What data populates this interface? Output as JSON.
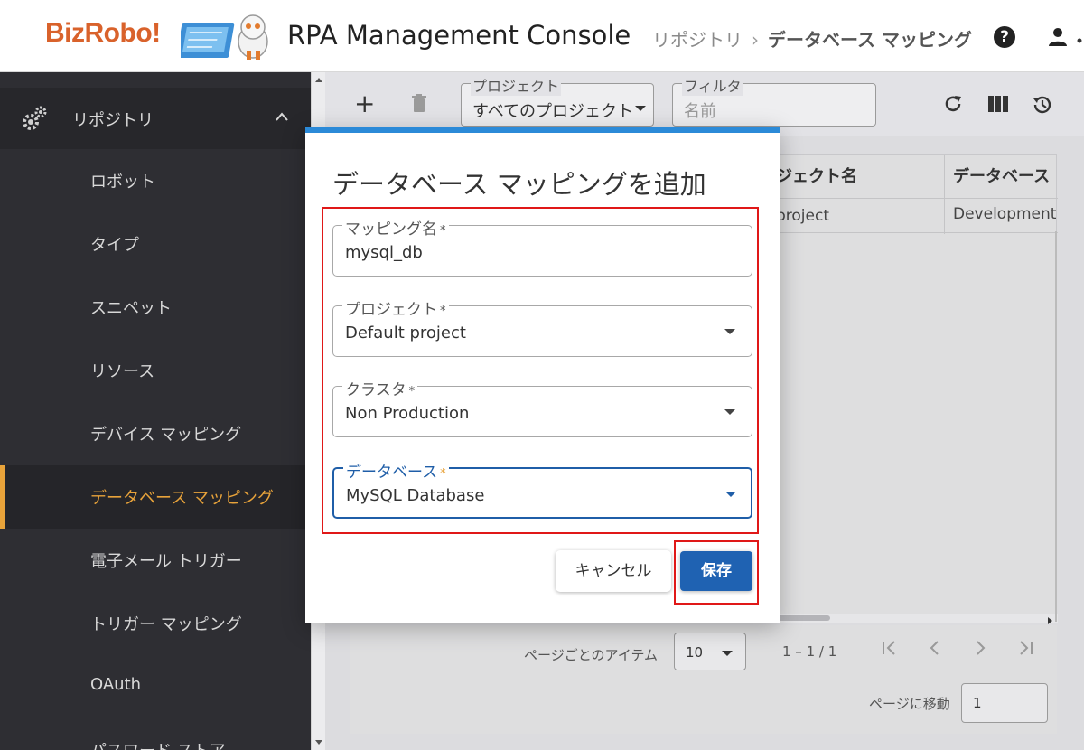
{
  "header": {
    "logo_text": "BizRobo!",
    "app_title": "RPA Management Console",
    "breadcrumb": {
      "parent": "リポジトリ",
      "separator": "›",
      "current": "データベース マッピング"
    },
    "help_glyph": "?",
    "icons": [
      "help-icon",
      "user-icon"
    ]
  },
  "sidebar": {
    "parent": {
      "label": "リポジトリ",
      "icon": "gear-icon",
      "expanded": true
    },
    "items": [
      {
        "label": "ロボット"
      },
      {
        "label": "タイプ"
      },
      {
        "label": "スニペット"
      },
      {
        "label": "リソース"
      },
      {
        "label": "デバイス マッピング"
      },
      {
        "label": "データベース マッピング",
        "active": true
      },
      {
        "label": "電子メール トリガー"
      },
      {
        "label": "トリガー マッピング"
      },
      {
        "label": "OAuth"
      },
      {
        "label": "パスワード ストア"
      }
    ],
    "active_color": "#e8a33a"
  },
  "toolbar": {
    "add_glyph": "+",
    "project_filter": {
      "label": "プロジェクト",
      "value": "すべてのプロジェクト"
    },
    "filter": {
      "label": "フィルタ",
      "placeholder": "名前"
    },
    "icons": [
      "plus-icon",
      "trash-icon",
      "refresh-icon",
      "columns-icon",
      "history-icon"
    ]
  },
  "table": {
    "columns": [
      "ジェクト名",
      "データベース"
    ],
    "rows": [
      [
        "project",
        "Development"
      ]
    ]
  },
  "pagination": {
    "items_per_page_label": "ページごとのアイテム",
    "items_per_page": "10",
    "range": "1 – 1 / 1",
    "goto_label": "ページに移動",
    "goto_value": "1"
  },
  "dialog": {
    "title": "データベース マッピングを追加",
    "required_mark": "*",
    "fields": {
      "mapping_name": {
        "label": "マッピング名",
        "value": "mysql_db"
      },
      "project": {
        "label": "プロジェクト",
        "value": "Default project"
      },
      "cluster": {
        "label": "クラスタ",
        "value": "Non Production"
      },
      "database": {
        "label": "データベース",
        "value": "MySQL Database"
      }
    },
    "cancel_label": "キャンセル",
    "save_label": "保存",
    "accent_color": "#2b8ad8",
    "primary_color": "#1f62b2",
    "highlight_color": "#e01818"
  }
}
